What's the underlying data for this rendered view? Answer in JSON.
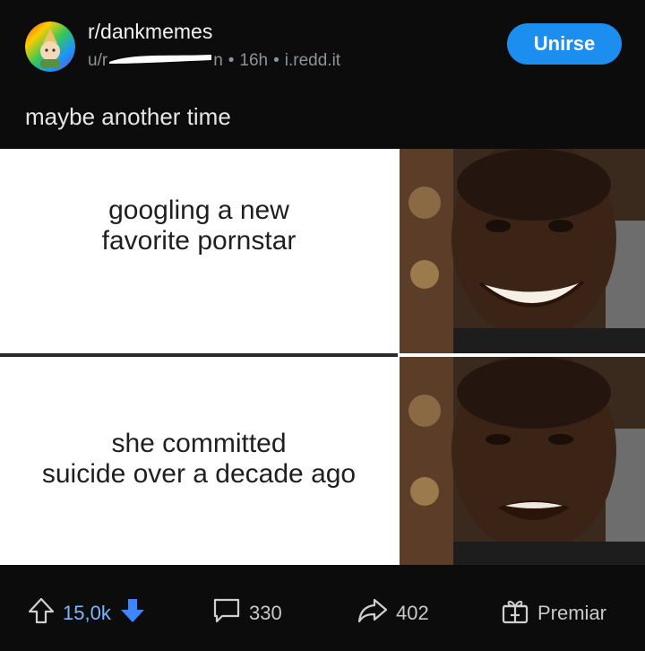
{
  "post": {
    "subreddit": "r/dankmemes",
    "user_prefix": "u/r",
    "user_suffix": "n",
    "age": "16h",
    "domain": "i.redd.it",
    "separator": "•",
    "title": "maybe another time"
  },
  "join_button": {
    "label": "Unirse"
  },
  "meme": {
    "top_text": [
      "googling a new",
      "favorite pornstar"
    ],
    "bottom_text": [
      "she committed",
      "suicide over a decade ago"
    ]
  },
  "footer": {
    "score": "15,0k",
    "comments": "330",
    "shares": "402",
    "award_label": "Premiar"
  },
  "colors": {
    "background": "#0c0c0d",
    "accent": "#1c8ef0",
    "upvote": "#7bb6ff",
    "downvote": "#3d86ff"
  },
  "icons": [
    "subreddit-avatar-icon",
    "upvote-arrow-icon",
    "downvote-arrow-icon",
    "comment-icon",
    "share-arrow-icon",
    "gift-icon"
  ]
}
